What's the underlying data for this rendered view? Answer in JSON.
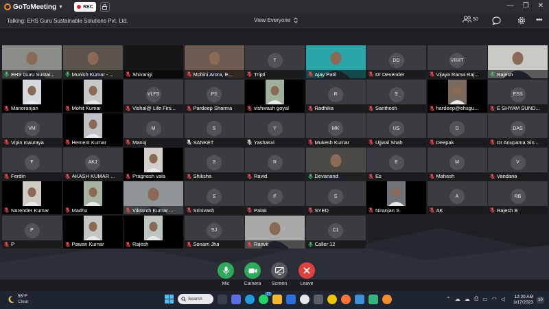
{
  "app": {
    "name": "GoToMeeting",
    "rec_label": "REC"
  },
  "infobar": {
    "talking": "Talking: EHS Guru Sustainable Solutions Pvt. Ltd.",
    "view": "View Everyone",
    "attendee_count": "50"
  },
  "participants": [
    {
      "name": "EHS Guru Sustai...",
      "mic": "on",
      "video": "person",
      "bg": "#8a8c88"
    },
    {
      "name": "Munish Kumar - ...",
      "mic": "on",
      "video": "person",
      "bg": "#5a544c"
    },
    {
      "name": "Shivangi",
      "mic": "off",
      "video": "dark",
      "bg": "#202020"
    },
    {
      "name": "Mohini Arora, E...",
      "mic": "off",
      "video": "person",
      "bg": "#6e5a50"
    },
    {
      "name": "Tripti",
      "mic": "off",
      "initials": "T"
    },
    {
      "name": "Ajay Patil",
      "mic": "off",
      "video": "person",
      "bg": "#2aa5a8"
    },
    {
      "name": "Dr Devender",
      "mic": "off",
      "initials": "DD"
    },
    {
      "name": "Vijaya Rama Raj...",
      "mic": "off",
      "initials": "VRRT"
    },
    {
      "name": "Rajesh",
      "mic": "on",
      "video": "person",
      "bg": "#c9c9c6"
    },
    {
      "name": "Manoranjan",
      "mic": "off",
      "video": "small",
      "bg": "#d6d9dd"
    },
    {
      "name": "Mohit Kumar",
      "mic": "off",
      "video": "small",
      "bg": "#c7c8c9"
    },
    {
      "name": "Vishal@ Life Firs...",
      "mic": "off",
      "initials": "VLFS"
    },
    {
      "name": "Pardeep Sharma",
      "mic": "off",
      "initials": "PS"
    },
    {
      "name": "vishwash goyal",
      "mic": "off",
      "video": "small",
      "bg": "#9fb09c"
    },
    {
      "name": "Radhika",
      "mic": "off",
      "initials": "R"
    },
    {
      "name": "Santhosh",
      "mic": "off",
      "initials": "S"
    },
    {
      "name": "hardeep@ehsgu...",
      "mic": "off",
      "video": "small",
      "bg": "#7a6a5e"
    },
    {
      "name": "E SHYAM SUND...",
      "mic": "off",
      "initials": "ESS"
    },
    {
      "name": "Vipin mauraya",
      "mic": "off",
      "initials": "VM"
    },
    {
      "name": "Hement Kumar",
      "mic": "off",
      "video": "small",
      "bg": "#bfc3c7"
    },
    {
      "name": "Manoj",
      "mic": "off",
      "initials": "M"
    },
    {
      "name": "SANKET",
      "mic": "muted",
      "initials": "S"
    },
    {
      "name": "Yashasvi",
      "mic": "muted",
      "initials": "Y"
    },
    {
      "name": "Mukesh Kumar",
      "mic": "off",
      "initials": "MK"
    },
    {
      "name": "Ujjwal Shah",
      "mic": "off",
      "initials": "US"
    },
    {
      "name": "Deepak",
      "mic": "off",
      "initials": "D"
    },
    {
      "name": "Dr Anupama Sin...",
      "mic": "off",
      "initials": "DAS"
    },
    {
      "name": "Ferdin",
      "mic": "off",
      "initials": "F"
    },
    {
      "name": "AKASH KUMAR ...",
      "mic": "off",
      "initials": "AKJ"
    },
    {
      "name": "Pragnesh vala",
      "mic": "off",
      "video": "small",
      "bg": "#d2cfc9"
    },
    {
      "name": "Shiksha",
      "mic": "off",
      "initials": "S"
    },
    {
      "name": "Ravid",
      "mic": "off",
      "initials": "R"
    },
    {
      "name": "Devanand",
      "mic": "on",
      "video": "person",
      "bg": "#4b4a46"
    },
    {
      "name": "Es",
      "mic": "off",
      "initials": "E"
    },
    {
      "name": "Mahesh",
      "mic": "off",
      "initials": "M"
    },
    {
      "name": "Vandana",
      "mic": "off",
      "initials": "V"
    },
    {
      "name": "Narender Kumar",
      "mic": "off",
      "video": "small",
      "bg": "#cfcac2"
    },
    {
      "name": "Madhu",
      "mic": "off",
      "video": "small",
      "bg": "#a7b2a0"
    },
    {
      "name": "Vikranth Kumar ...",
      "mic": "off",
      "video": "person",
      "bg": "#8f9497"
    },
    {
      "name": "Srinivash",
      "mic": "off",
      "initials": "S"
    },
    {
      "name": "Palak",
      "mic": "off",
      "initials": "P"
    },
    {
      "name": "SYED",
      "mic": "off",
      "initials": "S"
    },
    {
      "name": "Niranjan S",
      "mic": "off",
      "video": "small",
      "bg": "#6f7478"
    },
    {
      "name": "AK",
      "mic": "off",
      "initials": "A"
    },
    {
      "name": "Rajesh B",
      "mic": "off",
      "initials": "RB"
    },
    {
      "name": "P",
      "mic": "off",
      "initials": "P"
    },
    {
      "name": "Pawan Kumar",
      "mic": "off",
      "video": "small",
      "bg": "#c4c6c2"
    },
    {
      "name": "Rajesh",
      "mic": "off",
      "video": "small",
      "bg": "#bcc6c0"
    },
    {
      "name": "Sonam Jha",
      "mic": "off",
      "initials": "SJ"
    },
    {
      "name": "Ranvir",
      "mic": "off",
      "video": "person",
      "bg": "#a9aaa8"
    },
    {
      "name": "Caller 12",
      "mic": "on",
      "initials": "C1"
    }
  ],
  "controls": {
    "mic": "Mic",
    "camera": "Camera",
    "screen": "Screen",
    "leave": "Leave"
  },
  "colors": {
    "mic": "#2faa5d",
    "camera": "#2faa5d",
    "screen": "#55585d",
    "leave": "#e0413f",
    "accent": "#f68d2e"
  },
  "taskbar": {
    "temperature": "55°F",
    "condition": "Clear",
    "search": "Search",
    "badge": "27",
    "time": "12:20 AM",
    "date": "3/17/2023",
    "notifications": "10"
  }
}
